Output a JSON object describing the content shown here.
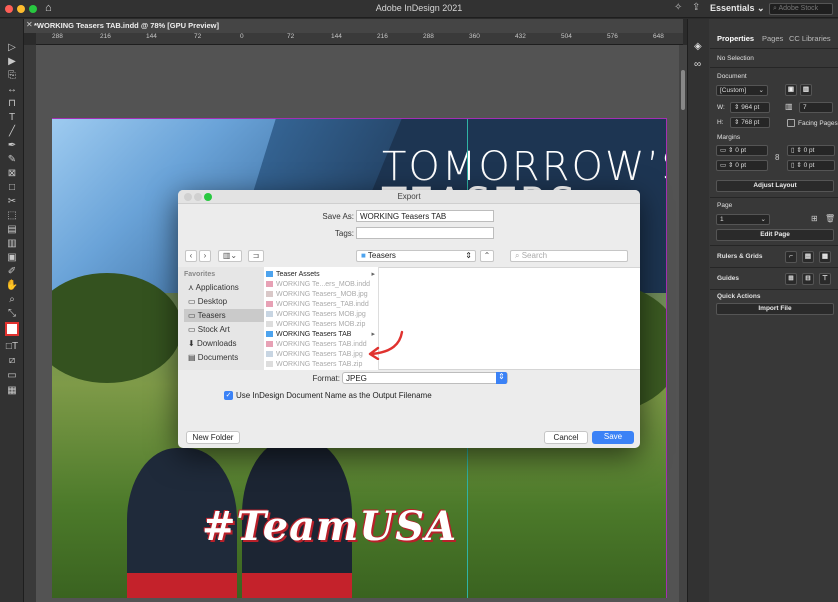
{
  "window": {
    "title": "Adobe InDesign 2021"
  },
  "topbar": {
    "workspace": "Essentials ⌄",
    "stock_search_placeholder": "Adobe Stock"
  },
  "document_tab": {
    "label": "*WORKING Teasers TAB.indd @ 78% [GPU Preview]"
  },
  "ruler": {
    "ticks": [
      "288",
      "216",
      "144",
      "72",
      "0",
      "72",
      "144",
      "216",
      "288",
      "360",
      "432",
      "504",
      "576",
      "648"
    ]
  },
  "artwork": {
    "headline_line1": "TOMORROW’S",
    "headline_line2": "TEASERS",
    "sign_text": "#TeamUSA"
  },
  "panel": {
    "tabs": [
      "Properties",
      "Pages",
      "CC Libraries"
    ],
    "selection": "No Selection",
    "document_heading": "Document",
    "preset": "[Custom]",
    "width_label": "W:",
    "width_value": "964 pt",
    "height_label": "H:",
    "height_value": "768 pt",
    "pages_count": "7",
    "facing_pages_label": "Facing Pages",
    "margins_heading": "Margins",
    "margin_top": "0 pt",
    "margin_bottom": "0 pt",
    "margin_left": "0 pt",
    "margin_right": "0 pt",
    "adjust_layout": "Adjust Layout",
    "page_heading": "Page",
    "page_value": "1",
    "edit_page": "Edit Page",
    "rulers_grids": "Rulers & Grids",
    "guides": "Guides",
    "quick_actions": "Quick Actions",
    "import_file": "Import File"
  },
  "dialog": {
    "title": "Export",
    "save_as_label": "Save As:",
    "save_as_value": "WORKING Teasers TAB",
    "tags_label": "Tags:",
    "tags_value": "",
    "location": "Teasers",
    "search_placeholder": "Search",
    "favorites_heading": "Favorites",
    "favorites": [
      "Applications",
      "Desktop",
      "Teasers",
      "Stock Art",
      "Downloads",
      "Documents"
    ],
    "files": [
      {
        "name": "Teaser Assets",
        "kind": "folder"
      },
      {
        "name": "WORKING Te...ers_MOB.indd",
        "kind": "indd"
      },
      {
        "name": "WORKING Teasers_MOB.jpg",
        "kind": "jpg"
      },
      {
        "name": "WORKING Teasers_TAB.indd",
        "kind": "indd"
      },
      {
        "name": "WORKING Teasers MOB.jpg",
        "kind": "jpg"
      },
      {
        "name": "WORKING Teasers MOB.zip",
        "kind": "zip"
      },
      {
        "name": "WORKING Teasers TAB",
        "kind": "folder"
      },
      {
        "name": "WORKING Teasers TAB.indd",
        "kind": "indd"
      },
      {
        "name": "WORKING Teasers TAB.jpg",
        "kind": "jpg"
      },
      {
        "name": "WORKING Teasers TAB.zip",
        "kind": "zip"
      }
    ],
    "format_label": "Format:",
    "format_value": "JPEG",
    "use_name_label": "Use InDesign Document Name as the Output Filename",
    "use_name_checked": true,
    "new_folder": "New Folder",
    "cancel": "Cancel",
    "save": "Save"
  },
  "colors": {
    "accent": "#3b82f6",
    "arrow": "#e0322f",
    "banner": "#1d3552",
    "guide": "#2fb3a5"
  }
}
